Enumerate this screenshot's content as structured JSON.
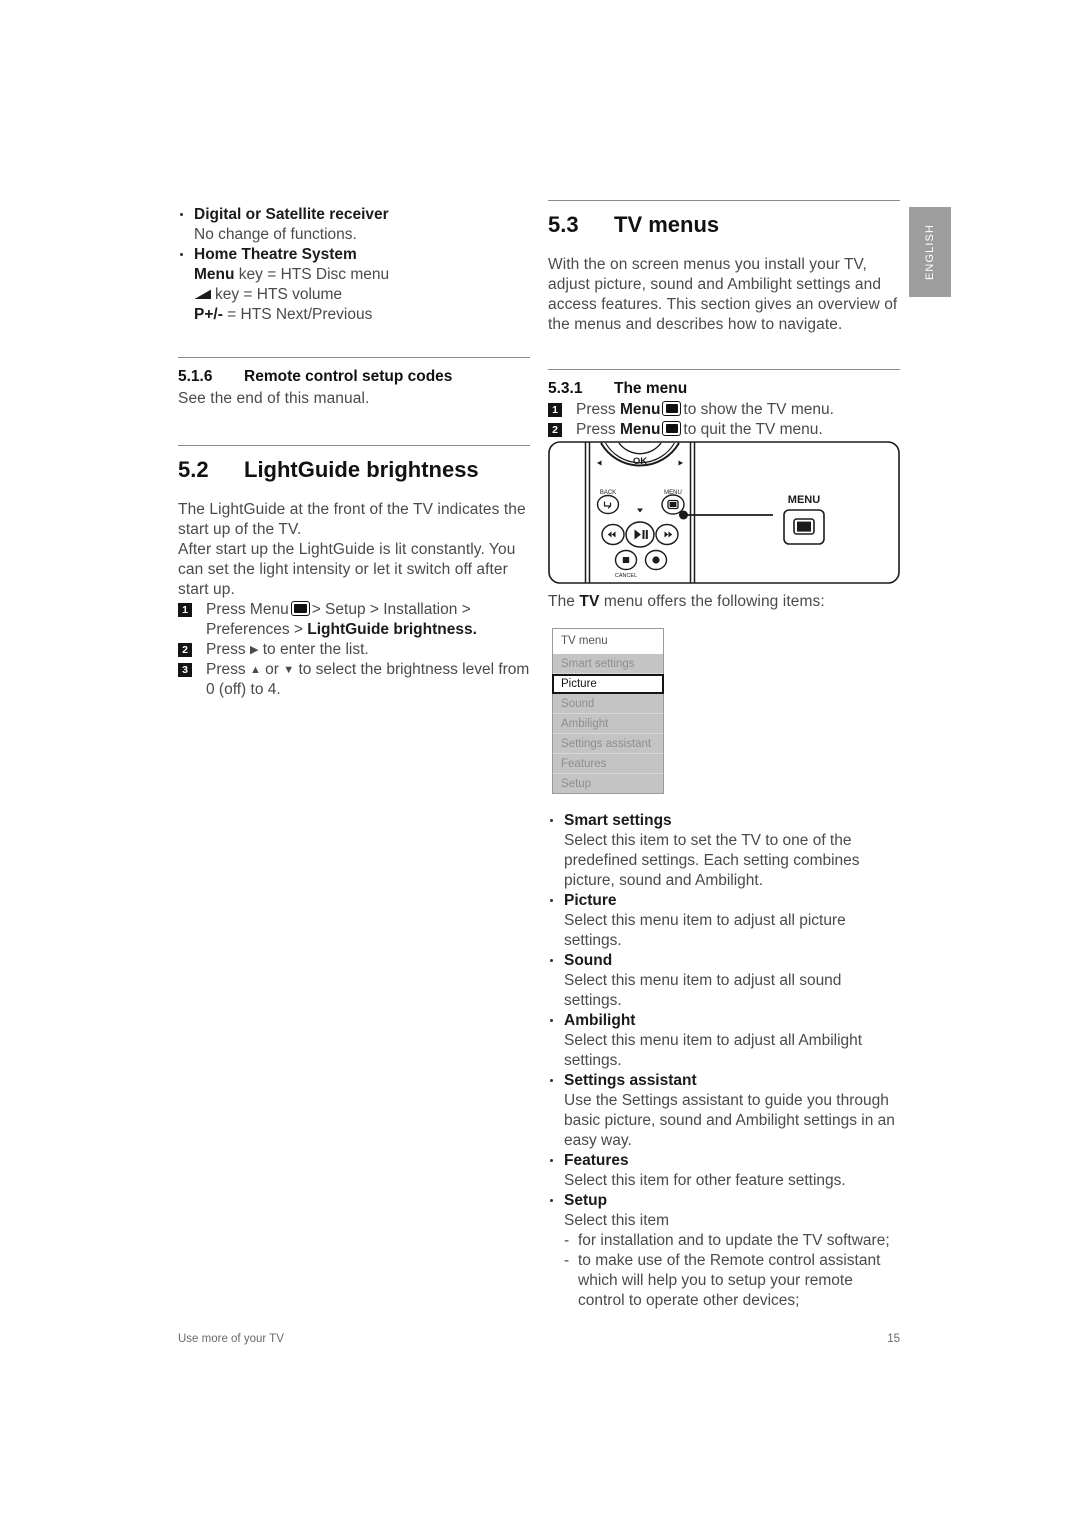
{
  "lang_tab": {
    "label": "ENGLISH"
  },
  "footer": {
    "left": "Use more of your TV",
    "page": "15"
  },
  "left_column": {
    "device_list": [
      {
        "term": "Digital or Satellite receiver",
        "def": "No change of functions."
      },
      {
        "term": "Home Theatre System",
        "def": ""
      }
    ],
    "hts_lines": {
      "line1_bold": "Menu",
      "line1_rest": "key = HTS Disc menu",
      "line2_rest": "key = HTS volume",
      "line3_bold": "P+/-",
      "line3_rest": "= HTS Next/Previous"
    },
    "section_516": {
      "number": "5.1.6",
      "title": "Remote control setup codes",
      "body": "See the end of this manual."
    },
    "section_52": {
      "number": "5.2",
      "title": "LightGuide brightness",
      "para1": "The LightGuide at the front of the TV indicates the start up of the TV.",
      "para2": "After start up the LightGuide is lit constantly. You can set the light intensity or let it switch off after start up.",
      "steps": [
        {
          "n": "1",
          "pre": "Press Menu",
          "post": "> Setup > Installation > Preferences >",
          "bold_tail": "LightGuide brightness",
          "tail_punct": "."
        },
        {
          "n": "2",
          "pre": "Press",
          "post": "to enter the list.",
          "bold_tail": "",
          "tail_punct": ""
        },
        {
          "n": "3",
          "pre": "Press",
          "post": "to select the brightness level from 0 (off) to 4.",
          "mid": "or",
          "bold_tail": "",
          "tail_punct": ""
        }
      ]
    }
  },
  "right_column": {
    "section_53": {
      "number": "5.3",
      "title": "TV menus",
      "body": "With the on screen menus you install your TV, adjust picture, sound and Ambilight settings and access features. This section gives an overview of the menus and describes how to navigate."
    },
    "section_531": {
      "number": "5.3.1",
      "title": "The menu",
      "steps": [
        {
          "n": "1",
          "pre": "Press",
          "bold": "Menu",
          "post": "to show the TV menu."
        },
        {
          "n": "2",
          "pre": "Press",
          "bold": "Menu",
          "post": "to quit the TV menu."
        }
      ]
    },
    "remote_figure": {
      "ok_label": "OK",
      "back_label": "BACK",
      "menu_label_small": "MENU",
      "cancel_label": "CANCEL",
      "callout_label": "MENU"
    },
    "intro_items": "The TV menu offers the following items:",
    "tv_menu_box": {
      "title": "TV menu",
      "items": [
        {
          "label": "Smart settings",
          "selected": false
        },
        {
          "label": "Picture",
          "selected": true
        },
        {
          "label": "Sound",
          "selected": false
        },
        {
          "label": "Ambilight",
          "selected": false
        },
        {
          "label": "Settings assistant",
          "selected": false
        },
        {
          "label": "Features",
          "selected": false
        },
        {
          "label": "Setup",
          "selected": false
        }
      ]
    },
    "menu_descriptions": [
      {
        "term": "Smart settings",
        "def": "Select this item to set the TV to one of the predefined settings. Each setting combines picture, sound and Ambilight."
      },
      {
        "term": "Picture",
        "def": "Select this menu item to adjust all picture settings."
      },
      {
        "term": "Sound",
        "def": "Select this menu item to adjust all sound settings."
      },
      {
        "term": "Ambilight",
        "def": "Select this menu item to adjust all Ambilight settings."
      },
      {
        "term": "Settings assistant",
        "def": "Use the Settings assistant to guide you through basic picture, sound and Ambilight settings in an easy way."
      },
      {
        "term": "Features",
        "def": "Select this item for other feature settings."
      },
      {
        "term": "Setup",
        "def": "Select this item",
        "sub": [
          "for installation and to update the TV software;",
          "to make use of the Remote control assistant which will help you to setup your remote control to operate other devices;"
        ]
      }
    ]
  },
  "colors": {
    "text": "#4a4a4a",
    "heading": "#111111",
    "rule": "#8b8b8b",
    "tab_bg": "#9d9d9d",
    "menu_row_bg": "#c4c4c4",
    "menu_row_text": "#8e8e8e"
  }
}
